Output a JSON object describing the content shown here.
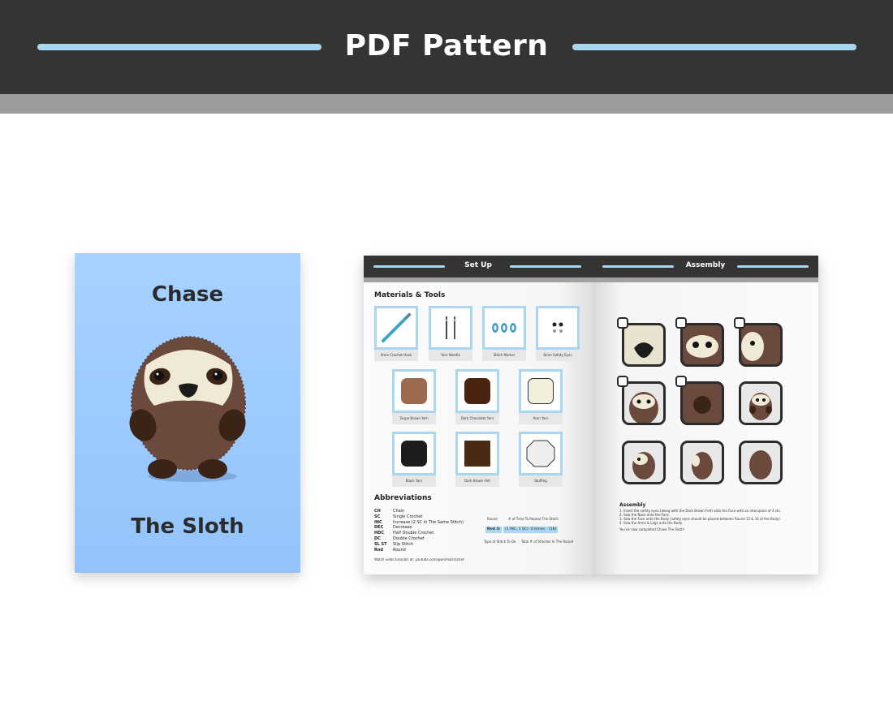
{
  "banner": {
    "title": "PDF Pattern"
  },
  "cover": {
    "name": "Chase",
    "subtitle": "The Sloth"
  },
  "setup_page": {
    "header": "Set Up",
    "materials_title": "Materials & Tools",
    "tools": [
      {
        "label": "4mm Crochet Hook",
        "icon": "crochet-hook"
      },
      {
        "label": "Yarn Needle",
        "icon": "yarn-needle"
      },
      {
        "label": "Stitch Marker",
        "icon": "stitch-marker"
      },
      {
        "label": "6mm Safety Eyes",
        "icon": "safety-eyes"
      }
    ],
    "yarns": [
      {
        "label": "Taupe Brown Yarn",
        "color": "#9c6a4c"
      },
      {
        "label": "Dark Chocolate Yarn",
        "color": "#4a2410"
      },
      {
        "label": "Aran Yarn",
        "color": "#f2efdc"
      },
      {
        "label": "Black Yarn",
        "color": "#1d1d1d"
      },
      {
        "label": "Dark Brown Felt",
        "color": "#4a2a14"
      },
      {
        "label": "Stuffing",
        "color": "#eeeeee"
      }
    ],
    "abbreviations_title": "Abbreviations",
    "abbreviations": [
      {
        "code": "CH",
        "meaning": "Chain"
      },
      {
        "code": "SC",
        "meaning": "Single Crochet"
      },
      {
        "code": "INC",
        "meaning": "Increase (2 SC In The Same Stitch)"
      },
      {
        "code": "DEC",
        "meaning": "Decrease"
      },
      {
        "code": "HDC",
        "meaning": "Half Double Crochet"
      },
      {
        "code": "DC",
        "meaning": "Double Crochet"
      },
      {
        "code": "SL ST",
        "meaning": "Slip Stitch"
      },
      {
        "code": "Rnd",
        "meaning": "Round"
      }
    ],
    "round_diagram": {
      "label_round": "Round",
      "label_repeat": "# of Time To Repeat The Stitch",
      "example_round": "Rnd 3:",
      "example_stitch": "(1 INC, 1 SC)",
      "example_times": "6 times.",
      "example_total": "[18]",
      "label_type": "Type of Stitch To Do",
      "label_total": "Total # of Stitches In The Round"
    },
    "watch_text": "Watch video tutorials at: youtube.com/@animalcrochet"
  },
  "assembly_page": {
    "header": "Assembly",
    "steps_title": "Assembly",
    "steps": [
      "1. Insert the safety eyes (along with the Dark Brown Felt) onto the Face with an interspace of 4 sts.",
      "2. Sew the Nose onto the Face.",
      "3. Sew the Face onto the Body (safety eyes should be placed between Round 15 & 16 of the Body).",
      "4. Sew the Arms & Legs onto the Body."
    ],
    "completion": "You've now completed Chase The Sloth!"
  },
  "colors": {
    "banner_bg": "#363433",
    "accent_blue": "#a9d6f1",
    "cover_blue": "#9ccaff",
    "sloth_brown": "#6b4a3d",
    "sloth_cream": "#efe9d6"
  }
}
